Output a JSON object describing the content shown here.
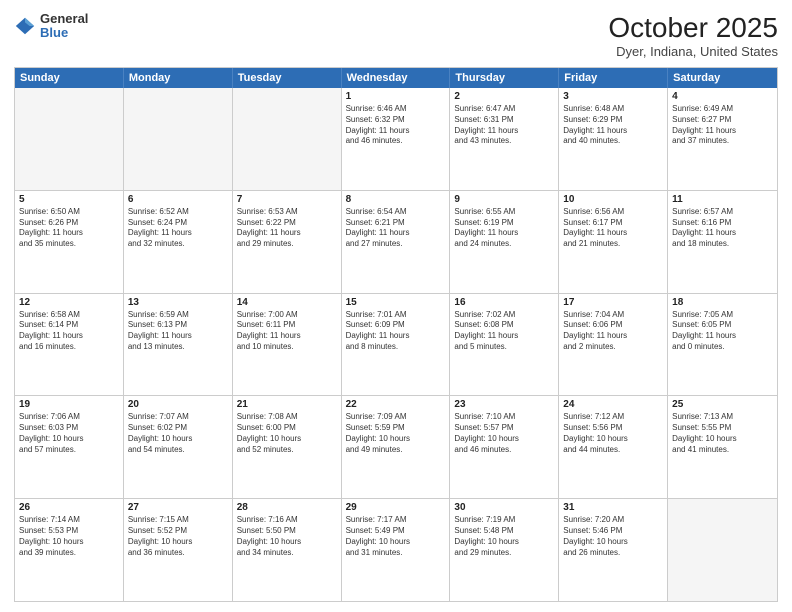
{
  "header": {
    "logo_general": "General",
    "logo_blue": "Blue",
    "title": "October 2025",
    "location": "Dyer, Indiana, United States"
  },
  "days_of_week": [
    "Sunday",
    "Monday",
    "Tuesday",
    "Wednesday",
    "Thursday",
    "Friday",
    "Saturday"
  ],
  "weeks": [
    [
      {
        "day": "",
        "text": "",
        "empty": true
      },
      {
        "day": "",
        "text": "",
        "empty": true
      },
      {
        "day": "",
        "text": "",
        "empty": true
      },
      {
        "day": "1",
        "text": "Sunrise: 6:46 AM\nSunset: 6:32 PM\nDaylight: 11 hours\nand 46 minutes.",
        "empty": false
      },
      {
        "day": "2",
        "text": "Sunrise: 6:47 AM\nSunset: 6:31 PM\nDaylight: 11 hours\nand 43 minutes.",
        "empty": false
      },
      {
        "day": "3",
        "text": "Sunrise: 6:48 AM\nSunset: 6:29 PM\nDaylight: 11 hours\nand 40 minutes.",
        "empty": false
      },
      {
        "day": "4",
        "text": "Sunrise: 6:49 AM\nSunset: 6:27 PM\nDaylight: 11 hours\nand 37 minutes.",
        "empty": false
      }
    ],
    [
      {
        "day": "5",
        "text": "Sunrise: 6:50 AM\nSunset: 6:26 PM\nDaylight: 11 hours\nand 35 minutes.",
        "empty": false
      },
      {
        "day": "6",
        "text": "Sunrise: 6:52 AM\nSunset: 6:24 PM\nDaylight: 11 hours\nand 32 minutes.",
        "empty": false
      },
      {
        "day": "7",
        "text": "Sunrise: 6:53 AM\nSunset: 6:22 PM\nDaylight: 11 hours\nand 29 minutes.",
        "empty": false
      },
      {
        "day": "8",
        "text": "Sunrise: 6:54 AM\nSunset: 6:21 PM\nDaylight: 11 hours\nand 27 minutes.",
        "empty": false
      },
      {
        "day": "9",
        "text": "Sunrise: 6:55 AM\nSunset: 6:19 PM\nDaylight: 11 hours\nand 24 minutes.",
        "empty": false
      },
      {
        "day": "10",
        "text": "Sunrise: 6:56 AM\nSunset: 6:17 PM\nDaylight: 11 hours\nand 21 minutes.",
        "empty": false
      },
      {
        "day": "11",
        "text": "Sunrise: 6:57 AM\nSunset: 6:16 PM\nDaylight: 11 hours\nand 18 minutes.",
        "empty": false
      }
    ],
    [
      {
        "day": "12",
        "text": "Sunrise: 6:58 AM\nSunset: 6:14 PM\nDaylight: 11 hours\nand 16 minutes.",
        "empty": false
      },
      {
        "day": "13",
        "text": "Sunrise: 6:59 AM\nSunset: 6:13 PM\nDaylight: 11 hours\nand 13 minutes.",
        "empty": false
      },
      {
        "day": "14",
        "text": "Sunrise: 7:00 AM\nSunset: 6:11 PM\nDaylight: 11 hours\nand 10 minutes.",
        "empty": false
      },
      {
        "day": "15",
        "text": "Sunrise: 7:01 AM\nSunset: 6:09 PM\nDaylight: 11 hours\nand 8 minutes.",
        "empty": false
      },
      {
        "day": "16",
        "text": "Sunrise: 7:02 AM\nSunset: 6:08 PM\nDaylight: 11 hours\nand 5 minutes.",
        "empty": false
      },
      {
        "day": "17",
        "text": "Sunrise: 7:04 AM\nSunset: 6:06 PM\nDaylight: 11 hours\nand 2 minutes.",
        "empty": false
      },
      {
        "day": "18",
        "text": "Sunrise: 7:05 AM\nSunset: 6:05 PM\nDaylight: 11 hours\nand 0 minutes.",
        "empty": false
      }
    ],
    [
      {
        "day": "19",
        "text": "Sunrise: 7:06 AM\nSunset: 6:03 PM\nDaylight: 10 hours\nand 57 minutes.",
        "empty": false
      },
      {
        "day": "20",
        "text": "Sunrise: 7:07 AM\nSunset: 6:02 PM\nDaylight: 10 hours\nand 54 minutes.",
        "empty": false
      },
      {
        "day": "21",
        "text": "Sunrise: 7:08 AM\nSunset: 6:00 PM\nDaylight: 10 hours\nand 52 minutes.",
        "empty": false
      },
      {
        "day": "22",
        "text": "Sunrise: 7:09 AM\nSunset: 5:59 PM\nDaylight: 10 hours\nand 49 minutes.",
        "empty": false
      },
      {
        "day": "23",
        "text": "Sunrise: 7:10 AM\nSunset: 5:57 PM\nDaylight: 10 hours\nand 46 minutes.",
        "empty": false
      },
      {
        "day": "24",
        "text": "Sunrise: 7:12 AM\nSunset: 5:56 PM\nDaylight: 10 hours\nand 44 minutes.",
        "empty": false
      },
      {
        "day": "25",
        "text": "Sunrise: 7:13 AM\nSunset: 5:55 PM\nDaylight: 10 hours\nand 41 minutes.",
        "empty": false
      }
    ],
    [
      {
        "day": "26",
        "text": "Sunrise: 7:14 AM\nSunset: 5:53 PM\nDaylight: 10 hours\nand 39 minutes.",
        "empty": false
      },
      {
        "day": "27",
        "text": "Sunrise: 7:15 AM\nSunset: 5:52 PM\nDaylight: 10 hours\nand 36 minutes.",
        "empty": false
      },
      {
        "day": "28",
        "text": "Sunrise: 7:16 AM\nSunset: 5:50 PM\nDaylight: 10 hours\nand 34 minutes.",
        "empty": false
      },
      {
        "day": "29",
        "text": "Sunrise: 7:17 AM\nSunset: 5:49 PM\nDaylight: 10 hours\nand 31 minutes.",
        "empty": false
      },
      {
        "day": "30",
        "text": "Sunrise: 7:19 AM\nSunset: 5:48 PM\nDaylight: 10 hours\nand 29 minutes.",
        "empty": false
      },
      {
        "day": "31",
        "text": "Sunrise: 7:20 AM\nSunset: 5:46 PM\nDaylight: 10 hours\nand 26 minutes.",
        "empty": false
      },
      {
        "day": "",
        "text": "",
        "empty": true
      }
    ]
  ]
}
